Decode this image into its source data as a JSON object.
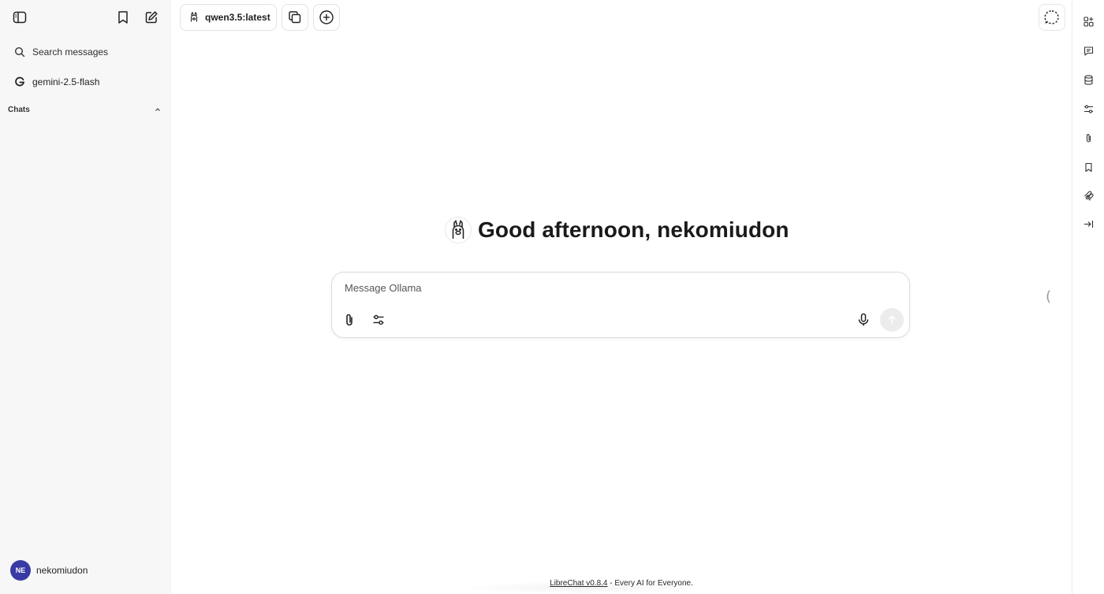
{
  "sidebar": {
    "search_label": "Search messages",
    "model_item": {
      "label": "gemini-2.5-flash",
      "icon": "google-g-icon"
    },
    "chats_header": "Chats",
    "user": {
      "initials": "NE",
      "name": "nekomiudon",
      "avatar_color": "#3a3aa5"
    }
  },
  "header": {
    "model_selector": {
      "label": "qwen3.5:latest",
      "icon": "llama-icon"
    }
  },
  "main": {
    "greeting": "Good afternoon, nekomiudon"
  },
  "composer": {
    "placeholder": "Message Ollama"
  },
  "footer": {
    "link_text": "LibreChat v0.8.4",
    "tagline": " - Every AI for Everyone."
  },
  "colors": {
    "sidebar_bg": "#f7f7f8",
    "avatar": "#3a3aa5"
  }
}
